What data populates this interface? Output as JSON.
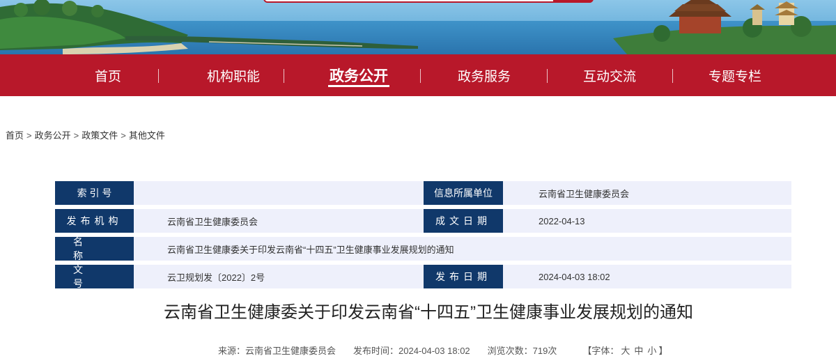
{
  "nav": {
    "items": [
      {
        "label": "首页",
        "active": false
      },
      {
        "label": "机构职能",
        "active": false
      },
      {
        "label": "政务公开",
        "active": true
      },
      {
        "label": "政务服务",
        "active": false
      },
      {
        "label": "互动交流",
        "active": false
      },
      {
        "label": "专题专栏",
        "active": false
      }
    ]
  },
  "breadcrumb": {
    "items": [
      "首页",
      "政务公开",
      "政策文件",
      "其他文件"
    ],
    "separator": ">"
  },
  "info": {
    "index_label": "索 引 号",
    "index_value": "",
    "unit_label": "信息所属单位",
    "unit_value": "云南省卫生健康委员会",
    "publisher_label": "发布机构",
    "publisher_value": "云南省卫生健康委员会",
    "created_label": "成文日期",
    "created_value": "2022-04-13",
    "name_label": "名 称",
    "name_value": "云南省卫生健康委关于印发云南省“十四五”卫生健康事业发展规划的通知",
    "docno_label": "文 号",
    "docno_value": "云卫规划发〔2022〕2号",
    "pubdate_label": "发布日期",
    "pubdate_value": "2024-04-03 18:02"
  },
  "article": {
    "title": "云南省卫生健康委关于印发云南省“十四五”卫生健康事业发展规划的通知",
    "source": "来源：云南省卫生健康委员会",
    "time": "发布时间：2024-04-03 18:02",
    "views": "浏览次数：719次",
    "font_open": "【字体：",
    "font_large": "大",
    "font_medium": "中",
    "font_small": "小",
    "font_close": "】"
  },
  "colors": {
    "brand_red": "#b8182a",
    "label_navy": "#10386a",
    "value_bg": "#eef0fb"
  }
}
